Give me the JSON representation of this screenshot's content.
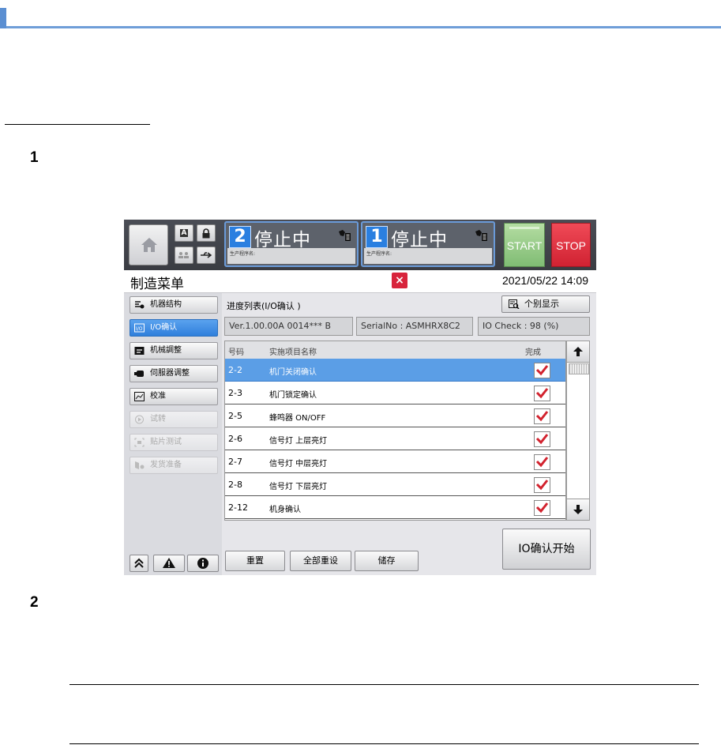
{
  "doc": {
    "step1": "1",
    "step2": "2"
  },
  "topbar": {
    "lane2": {
      "number": "2",
      "status": "停止中",
      "program_label": "生产程序名:"
    },
    "lane1": {
      "number": "1",
      "status": "停止中",
      "program_label": "生产程序名:"
    },
    "small_a": "A",
    "start_label": "START",
    "stop_label": "STOP"
  },
  "window": {
    "title": "制造菜单",
    "close": "×",
    "datetime": "2021/05/22 14:09"
  },
  "sidebar": {
    "items": [
      {
        "label": "机器结构",
        "state": "normal"
      },
      {
        "label": "I/O确认",
        "state": "active"
      },
      {
        "label": "机械調整",
        "state": "normal"
      },
      {
        "label": "伺服器调整",
        "state": "normal"
      },
      {
        "label": "校准",
        "state": "normal"
      },
      {
        "label": "试转",
        "state": "disabled"
      },
      {
        "label": "贴片测试",
        "state": "disabled"
      },
      {
        "label": "发货准备",
        "state": "disabled"
      }
    ]
  },
  "main": {
    "progress_title": "进度列表(I/O确认 )",
    "detail_button": "个别显示",
    "version": "Ver.1.00.00A 0014*** B",
    "serial": "SerialNo : ASMHRX8C2",
    "io_check": "IO Check : 98 (%)",
    "table": {
      "headers": {
        "no": "号码",
        "name": "实施项目名称",
        "done": "完成"
      },
      "rows": [
        {
          "no": "2-2",
          "name": "机门关闭确认",
          "done": true
        },
        {
          "no": "2-3",
          "name": "机门锁定确认",
          "done": true
        },
        {
          "no": "2-5",
          "name": "蜂鸣器 ON/OFF",
          "done": true
        },
        {
          "no": "2-6",
          "name": "信号灯 上层亮灯",
          "done": true
        },
        {
          "no": "2-7",
          "name": "信号灯 中层亮灯",
          "done": true
        },
        {
          "no": "2-8",
          "name": "信号灯 下层亮灯",
          "done": true
        },
        {
          "no": "2-12",
          "name": "机身确认",
          "done": true
        }
      ]
    },
    "reset_button": "重置",
    "reset_all_button": "全部重设",
    "save_button": "储存",
    "io_start_button": "IO确认开始"
  }
}
